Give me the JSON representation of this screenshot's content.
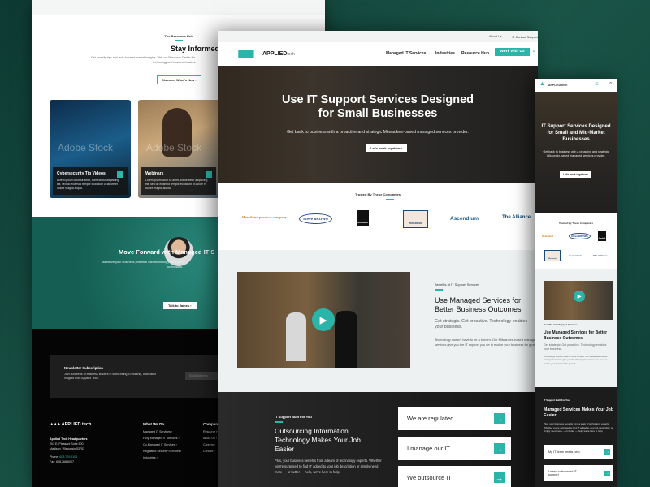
{
  "left_page": {
    "resource": {
      "eyebrow": "The Resource Hub",
      "title": "Stay Informed with the Latest Insights o",
      "text1": "Get security tips and tech-focused market insights. Visit our Resource Center for",
      "text2": "technology and business leaders.",
      "button": "Discover What's New ›"
    },
    "cards": [
      {
        "title": "Cybersecurity Tip Videos",
        "text": "Lorem ipsum dolor sit amet, consectetur adipiscing elit, sed do eiusmod tempor incididunt ut labore et dolore magna aliqua.",
        "watermark": "Adobe Stock"
      },
      {
        "title": "Webinars",
        "text": "Lorem ipsum dolor sit amet, consectetur adipiscing elit, sed do eiusmod tempor incididunt ut labore et dolore magna aliqua.",
        "watermark": "Adobe Stock"
      }
    ],
    "cta": {
      "title": "Move Forward with Managed IT S",
      "text1": "Maximize your business potential with technology services fo",
      "text2": "businesses.",
      "button": "Talk to James ›"
    },
    "newsletter": {
      "title": "Newsletter Subscription",
      "text": "Join hundreds of business leaders in subscribing to monthly, actionable insights from Applied Tech.",
      "placeholder": "Email Address"
    },
    "footer": {
      "logo": "APPLIED tech",
      "hq": "Applied Tech Headquarters",
      "addr1": "203 E. Pleasant Suite 500",
      "addr2": "Madison, Wisconsin 53703",
      "phone_label": "Phone:",
      "phone": "608.729.1100",
      "fax": "Fax: 608.268.6007",
      "col1_title": "What We Do",
      "col1": [
        "Managed IT Services ›",
        "Fully Managed IT Services ›",
        "Co-Managed IT Services ›",
        "Regulated Security Services ›",
        "Industries ›"
      ],
      "col2_title": "Compan",
      "col2": [
        "Resource H",
        "About Us ›",
        "Careers ›",
        "Contact ›"
      ]
    }
  },
  "main_page": {
    "topbar": {
      "about": "About Us",
      "support": "Contact Support"
    },
    "logo": {
      "brand": "APPLIED",
      "suffix": "tech"
    },
    "nav": {
      "managed": "Managed IT Services",
      "industries": "Industries",
      "resource": "Resource Hub",
      "cta": "Work with Us"
    },
    "hero": {
      "title1": "Use IT Support Services Designed",
      "title2": "for Small Businesses",
      "subtitle": "Get back to business with a proactive and strategic Milwaukee-based managed services provider.",
      "button": "Let's work together ›"
    },
    "trusted": {
      "eyebrow": "Trusted By These Companies",
      "logos": [
        "Heartland produce company",
        "Steve BROWN",
        "Goodwill",
        "Wisconsin",
        "Ascendium",
        "The Alliance"
      ]
    },
    "benefits": {
      "eyebrow": "Benefits of IT Support Services",
      "title1": "Use Managed Services for",
      "title2": "Better Business Outcomes",
      "lead": "Get strategic. Get proactive. Technology enables your business.",
      "body": "Technology doesn't have to be a burden. Our Milwaukee-based managed services give you the IT support you ne to evolve your business for growth."
    },
    "built": {
      "eyebrow": "IT Support Built For You",
      "title": "Outsourcing Information Technology Makes Your Job Easier",
      "body": "Plus, your business benefits from a team of technology experts. Whether you're surprised to find IT added to your job description or simply need more — or better — help, we're here to help.",
      "choices": [
        "We are regulated",
        "I manage our IT",
        "We outsource IT"
      ]
    }
  },
  "mobile_page": {
    "logo": "APPLIED tech",
    "hero": {
      "title": "IT Support Services Designed for Small and Mid-Market Businesses",
      "subtitle": "Get back to business with a proactive and strategic Wisconsin-based managed services provider.",
      "button": "Let's work together ›"
    },
    "trusted": {
      "eyebrow": "Trusted By These Companies",
      "logos": [
        "Heartland",
        "Steve BROWN",
        "Goodwill",
        "Wisconsin",
        "Ascendium",
        "The Alliance"
      ]
    },
    "benefits": {
      "eyebrow": "Benefits of IT Support Services",
      "title": "Use Managed Services for Better Business Outcomes",
      "lead": "Get strategic. Get proactive. Technology enables your business.",
      "body": "Technology doesn't have to be a burden. Our Milwaukee-based managed services give you the IT support services you need to evolve your business for growth."
    },
    "built": {
      "eyebrow": "IT Support Built For You",
      "title": "Managed Services Makes Your Job Easier",
      "body": "Plus, your business benefits from a team of technology experts. Whether you're surprised to find IT added to your job description or simply need more — or better — help, we're here to help.",
      "choices": [
        "My IT team needs help",
        "I need outsourced IT support"
      ]
    }
  },
  "colors": {
    "accent": "#2bb5a8",
    "dark": "#1a1a1a",
    "teal_band": "#1f7a6d",
    "light_bg": "#eef1f2"
  }
}
